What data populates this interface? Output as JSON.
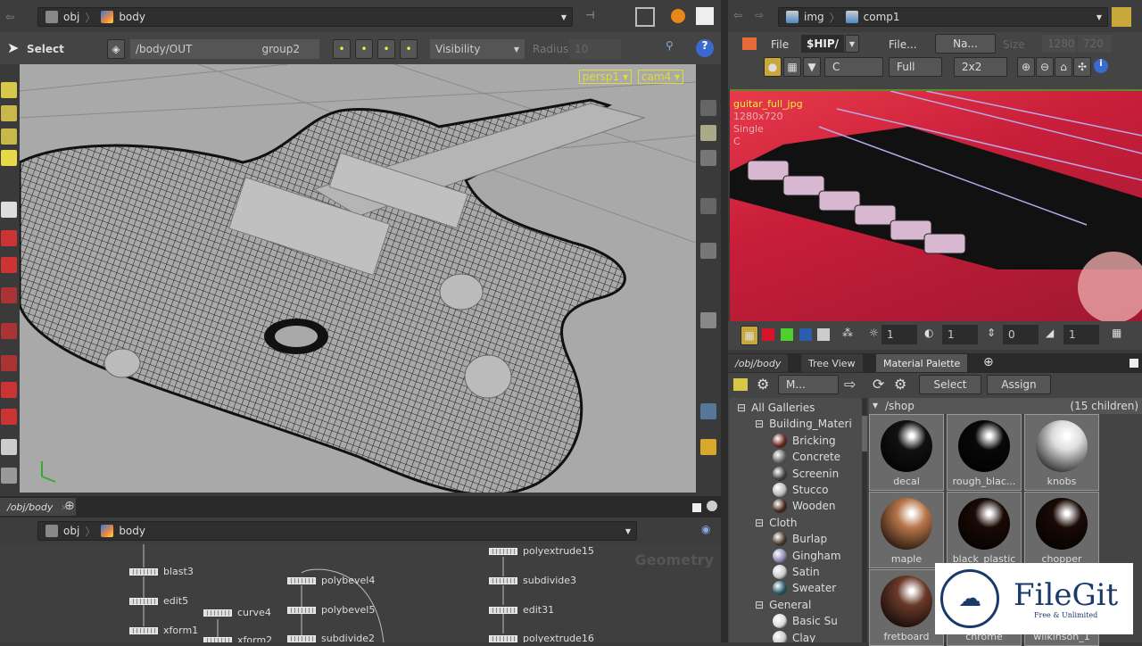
{
  "left_pane": {
    "breadcrumb": [
      {
        "label": "obj",
        "icon": "obj-network-icon"
      },
      {
        "label": "body",
        "icon": "geometry-object-icon"
      }
    ],
    "toolbar": {
      "mode_label": "Select",
      "path": "/body/OUT",
      "group": "group2",
      "visibility": "Visibility",
      "radius_label": "Radius",
      "radius_value": "10"
    },
    "viewport": {
      "camera_persp": "persp1",
      "camera_cam": "cam4",
      "background": "#a9a9a9"
    }
  },
  "network_pane": {
    "tab_label": "/obj/body",
    "breadcrumb": [
      {
        "label": "obj"
      },
      {
        "label": "body"
      }
    ],
    "watermark": "Geometry",
    "nodes": [
      {
        "name": "blast3"
      },
      {
        "name": "edit5"
      },
      {
        "name": "xform1"
      },
      {
        "name": "curve4"
      },
      {
        "name": "xform2"
      },
      {
        "name": "polybevel4"
      },
      {
        "name": "polybevel5"
      },
      {
        "name": "subdivide2"
      },
      {
        "name": "polyextrude15"
      },
      {
        "name": "subdivide3"
      },
      {
        "name": "edit31"
      },
      {
        "name": "polyextrude16"
      }
    ]
  },
  "right_pane": {
    "breadcrumb": [
      {
        "label": "img"
      },
      {
        "label": "comp1"
      }
    ],
    "toolbar1": {
      "file_label": "File",
      "file_path": "$HIP/",
      "file_btn": "File...",
      "name_select": "Na...",
      "size_label": "Size",
      "size_w": "1280",
      "size_h": "720"
    },
    "toolbar2": {
      "channel": "C",
      "resolution": "Full",
      "tiles": "2x2"
    },
    "image": {
      "name": "guitar_full_jpg",
      "resolution": "1280x720",
      "mode": "Single",
      "channel": "C"
    },
    "bottom_toolbar": {
      "v1": "1",
      "v2": "1",
      "v3": "0",
      "v4": "1"
    },
    "colors": {
      "red": "#d8142a",
      "green": "#4dd02a",
      "blue": "#2a5fb0"
    }
  },
  "lower_tabs": [
    {
      "label": "/obj/body"
    },
    {
      "label": "Tree View"
    },
    {
      "label": "Material Palette",
      "active": true
    }
  ],
  "material_palette": {
    "select_label": "Select",
    "assign_label": "Assign",
    "filter": "M...",
    "shop_path": "/shop",
    "children": "(15 children)",
    "galleries": [
      {
        "label": "All Galleries",
        "level": 0
      },
      {
        "label": "Building_Materi",
        "level": 1
      },
      {
        "label": "Bricking",
        "level": 2,
        "color": "#6a2a22"
      },
      {
        "label": "Concrete",
        "level": 2,
        "color": "#666"
      },
      {
        "label": "Screenin",
        "level": 2,
        "color": "#444"
      },
      {
        "label": "Stucco",
        "level": 2,
        "color": "#bbb"
      },
      {
        "label": "Wooden",
        "level": 2,
        "color": "#4a2a1a"
      },
      {
        "label": "Cloth",
        "level": 1
      },
      {
        "label": "Burlap",
        "level": 2,
        "color": "#4a3a2a"
      },
      {
        "label": "Gingham",
        "level": 2,
        "color": "#8a8ab0"
      },
      {
        "label": "Satin",
        "level": 2,
        "color": "#ccc"
      },
      {
        "label": "Sweater",
        "level": 2,
        "color": "#2a5a6a"
      },
      {
        "label": "General",
        "level": 1
      },
      {
        "label": "Basic Su",
        "level": 2,
        "color": "#ddd"
      },
      {
        "label": "Clay",
        "level": 2,
        "color": "#ccc"
      }
    ],
    "materials": [
      {
        "label": "decal",
        "color": "#111"
      },
      {
        "label": "rough_blac...",
        "color": "#080808"
      },
      {
        "label": "knobs",
        "color": "#ddd"
      },
      {
        "label": "maple",
        "color": "#b8764a"
      },
      {
        "label": "black_plastic",
        "color": "#1a0a05"
      },
      {
        "label": "chopper",
        "color": "#1a0a05"
      },
      {
        "label": "fretboard",
        "color": "#6a3a2a"
      },
      {
        "label": "chrome",
        "color": "#999"
      },
      {
        "label": "wilkinson_1",
        "color": "#888"
      }
    ]
  },
  "watermark_logo": {
    "title": "FileGit",
    "subtitle": "Free & Unlimited"
  }
}
